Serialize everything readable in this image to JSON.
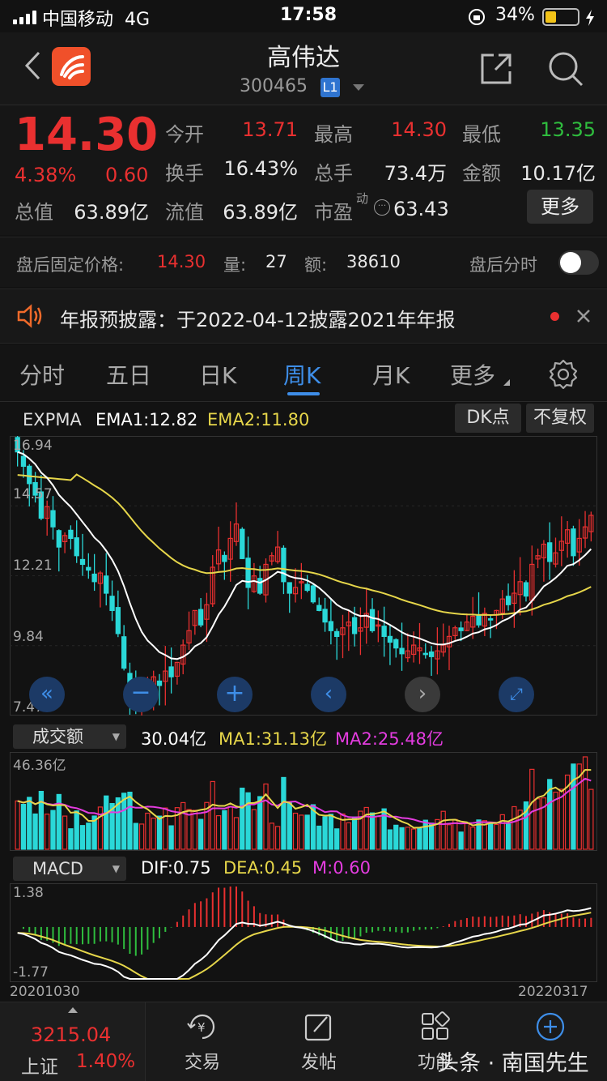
{
  "status": {
    "carrier": "中国移动",
    "network": "4G",
    "time": "17:58",
    "battery": "34%"
  },
  "header": {
    "title": "高伟达",
    "code": "300465",
    "level": "L1"
  },
  "quote": {
    "price": "14.30",
    "change_pct": "4.38%",
    "change": "0.60",
    "open_label": "今开",
    "open": "13.71",
    "high_label": "最高",
    "high": "14.30",
    "low_label": "最低",
    "low": "13.35",
    "turnover_label": "换手",
    "turnover": "16.43%",
    "volume_label": "总手",
    "volume": "73.4万",
    "amount_label": "金额",
    "amount": "10.17亿",
    "mktcap_label": "总值",
    "mktcap": "63.89亿",
    "float_label": "流值",
    "float_cap": "63.89亿",
    "pe_label": "市盈",
    "pe_sup": "动",
    "pe": "63.43",
    "more": "更多"
  },
  "after_hours": {
    "label": "盘后固定价格:",
    "price": "14.30",
    "vol_label": "量:",
    "vol": "27",
    "amt_label": "额:",
    "amt": "38610",
    "toggle_label": "盘后分时"
  },
  "notice": {
    "text": "年报预披露：于2022-04-12披露2021年年报"
  },
  "tabs": [
    "分时",
    "五日",
    "日K",
    "周K",
    "月K",
    "更多"
  ],
  "chart": {
    "indicator": "EXPMA",
    "ema1_label": "EMA1:12.82",
    "ema2_label": "EMA2:11.80",
    "dk_button": "DK点",
    "adjust_button": "不复权",
    "price_ticks": [
      "16.94",
      "14.57",
      "12.21",
      "9.84",
      "7.47"
    ],
    "vol_select": "成交额",
    "vol_value": "30.04亿",
    "vol_ma1": "MA1:31.13亿",
    "vol_ma2": "MA2:25.48亿",
    "vol_max": "46.36亿",
    "macd_select": "MACD",
    "dif": "DIF:0.75",
    "dea": "DEA:0.45",
    "m": "M:0.60",
    "macd_top": "1.38",
    "macd_bottom": "-1.77",
    "date_start": "20201030",
    "date_end": "20220317"
  },
  "chart_data": {
    "type": "candlestick",
    "x_start": "20201030",
    "x_end": "20220317",
    "ylim": [
      7.47,
      16.94
    ],
    "series": [
      {
        "name": "EMA1",
        "last": 12.82
      },
      {
        "name": "EMA2",
        "last": 11.8
      }
    ],
    "close_approx": [
      16.5,
      16.0,
      15.4,
      15.0,
      14.2,
      14.6,
      13.9,
      13.2,
      13.6,
      13.5,
      12.9,
      12.6,
      12.4,
      12.0,
      12.3,
      11.6,
      11.0,
      10.2,
      9.0,
      8.0,
      7.7,
      7.8,
      8.3,
      8.7,
      8.4,
      8.9,
      8.7,
      9.2,
      9.8,
      10.3,
      11.0,
      10.5,
      11.2,
      12.5,
      13.1,
      12.7,
      13.5,
      14.0,
      12.8,
      11.8,
      12.2,
      11.6,
      12.6,
      12.9,
      13.2,
      12.0,
      11.6,
      11.8,
      12.0,
      11.7,
      11.3,
      11.0,
      10.6,
      10.3,
      10.1,
      10.4,
      10.6,
      10.2,
      10.4,
      10.9,
      10.3,
      10.5,
      10.1,
      9.9,
      9.7,
      9.5,
      9.6,
      9.8,
      9.7,
      9.5,
      9.4,
      9.6,
      9.8,
      10.1,
      10.4,
      10.3,
      10.6,
      10.8,
      10.5,
      10.9,
      10.7,
      11.0,
      11.4,
      11.2,
      11.6,
      12.0,
      11.5,
      12.6,
      12.9,
      13.3,
      12.7,
      13.0,
      13.4,
      13.8,
      12.9,
      13.5,
      13.9,
      14.3
    ],
    "volume_max": 46.36,
    "macd_range": [
      -1.77,
      1.38
    ],
    "dif_last": 0.75,
    "dea_last": 0.45,
    "m_last": 0.6
  },
  "index": {
    "value": "3215.04",
    "name": "上证",
    "pct": "1.40%"
  },
  "nav": {
    "trade": "交易",
    "post": "发帖",
    "func": "功能"
  },
  "watermark": "头条 · 南国先生",
  "colors": {
    "up": "#e93030",
    "down": "#2ad8d8",
    "ema1": "#ffffff",
    "ema2": "#e6d64a",
    "ma2": "#e43ce0",
    "accent": "#3e8ee8"
  }
}
